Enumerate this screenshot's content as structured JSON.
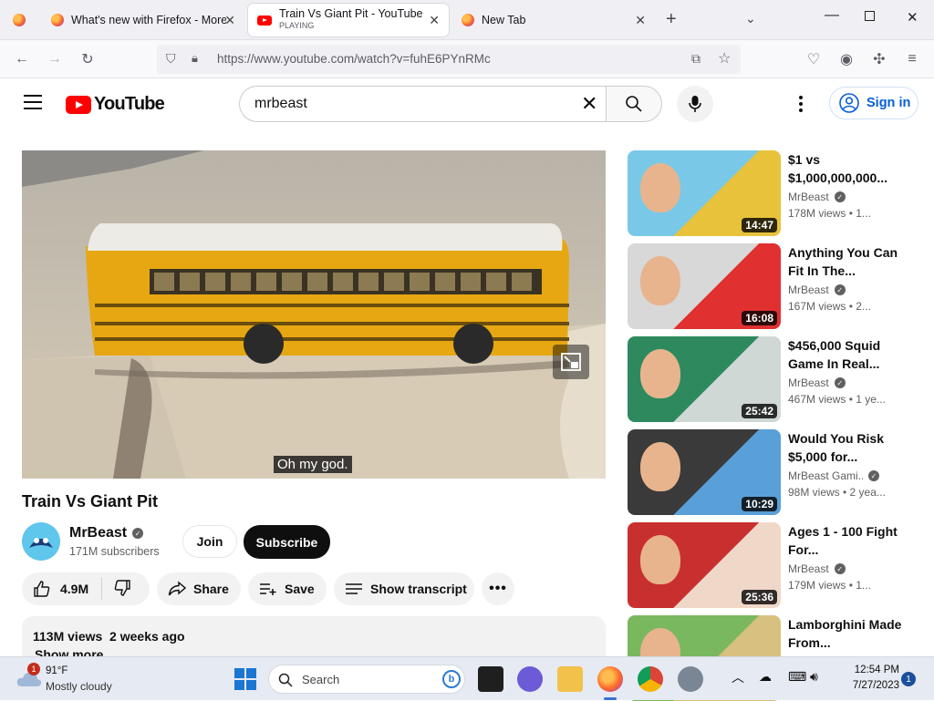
{
  "browser": {
    "tabs": [
      {
        "label": "",
        "state": ""
      },
      {
        "label": "What's new with Firefox - More",
        "state": ""
      },
      {
        "label": "Train Vs Giant Pit - YouTube",
        "state": "PLAYING"
      },
      {
        "label": "New Tab",
        "state": ""
      }
    ],
    "url": "https://www.youtube.com/watch?v=fuhE6PYnRMc"
  },
  "youtube": {
    "logo_text": "YouTube",
    "search_value": "mrbeast",
    "signin_label": "Sign in"
  },
  "player": {
    "caption": "Oh my god."
  },
  "video": {
    "title": "Train Vs Giant Pit",
    "channel": "MrBeast",
    "subscribers": "171M subscribers",
    "join_label": "Join",
    "subscribe_label": "Subscribe",
    "likes": "4.9M",
    "share_label": "Share",
    "save_label": "Save",
    "transcript_label": "Show transcript",
    "views_line": "113M views  2 weeks ago",
    "show_more": "Show more"
  },
  "recommendations": [
    {
      "title": "$1 vs $1,000,000,000...",
      "channel": "MrBeast",
      "meta": "178M views • 1...",
      "duration": "14:47",
      "colors": [
        "#7ac8e8",
        "#e8c23a"
      ]
    },
    {
      "title": "Anything You Can Fit In The...",
      "channel": "MrBeast",
      "meta": "167M views • 2...",
      "duration": "16:08",
      "colors": [
        "#d8d8d8",
        "#e03030"
      ]
    },
    {
      "title": "$456,000 Squid Game In Real...",
      "channel": "MrBeast",
      "meta": "467M views • 1 ye...",
      "duration": "25:42",
      "colors": [
        "#2e8a5e",
        "#cfd8d4"
      ]
    },
    {
      "title": "Would You Risk $5,000 for...",
      "channel": "MrBeast Gami...",
      "meta": "98M views • 2 yea...",
      "duration": "10:29",
      "colors": [
        "#3a3a3a",
        "#5aa0d8"
      ]
    },
    {
      "title": "Ages 1 - 100 Fight For...",
      "channel": "MrBeast",
      "meta": "179M views • 1...",
      "duration": "25:36",
      "colors": [
        "#c83030",
        "#f0d8c8"
      ]
    },
    {
      "title": "Lamborghini Made From...",
      "channel": "",
      "meta": "",
      "duration": "",
      "colors": [
        "#7ab860",
        "#d8c080"
      ]
    }
  ],
  "taskbar": {
    "weather_temp": "91°F",
    "weather_desc": "Mostly cloudy",
    "weather_badge": "1",
    "search_placeholder": "Search",
    "time": "12:54 PM",
    "date": "7/27/2023",
    "notif_count": "1"
  }
}
